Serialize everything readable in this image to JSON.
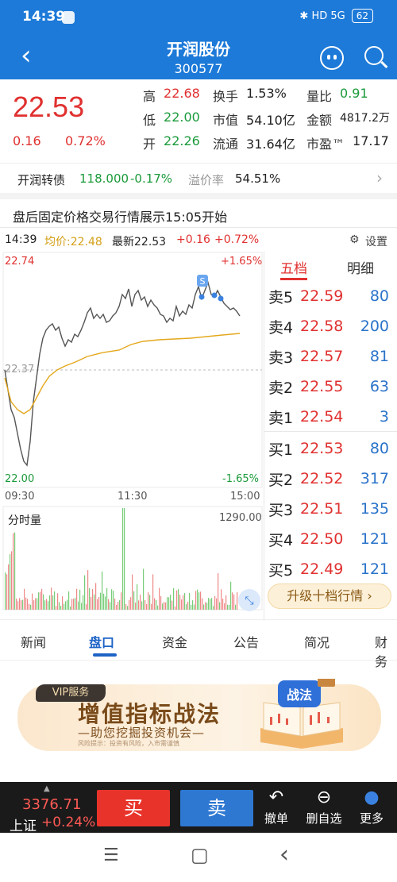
{
  "status_bar": {
    "time": "14:39",
    "icons": "✱ HD 5G",
    "battery": "62"
  },
  "header": {
    "title": "开润股份",
    "code": "300577"
  },
  "quote": {
    "price": "22.53",
    "change": "0.16",
    "change_pct": "0.72%",
    "stats": [
      [
        {
          "label": "高",
          "value": "22.68",
          "color": "red"
        },
        {
          "label": "换手",
          "value": "1.53%",
          "color": "dark"
        },
        {
          "label": "量比",
          "value": "0.91",
          "color": "green"
        }
      ],
      [
        {
          "label": "低",
          "value": "22.00",
          "color": "green"
        },
        {
          "label": "市值",
          "value": "54.10亿",
          "color": "dark"
        },
        {
          "label": "金额",
          "value": "4817.2万",
          "color": "dark"
        }
      ],
      [
        {
          "label": "开",
          "value": "22.26",
          "color": "green"
        },
        {
          "label": "流通",
          "value": "31.64亿",
          "color": "dark"
        },
        {
          "label": "市盈™",
          "value": "17.17",
          "color": "dark"
        }
      ]
    ]
  },
  "bond": {
    "name": "开润转债",
    "price": "118.000",
    "change": "-0.17%",
    "premium_label": "溢价率",
    "premium": "54.51%"
  },
  "notice": "盘后固定价格交易行情展示15:05开始",
  "chart": {
    "time": "14:39",
    "avg_label": "均价:22.48",
    "latest_label": "最新22.53",
    "chg": "+0.16",
    "chg_pct": "+0.72%",
    "settings": "设置",
    "y_high": "22.74",
    "y_mid": "22.37",
    "y_low": "22.00",
    "pct_high": "+1.65%",
    "pct_low": "-1.65%",
    "t_start": "09:30",
    "t_mid": "11:30",
    "t_end": "15:00",
    "volume_label": "分时量",
    "volume_max": "1290.00",
    "marker": "S"
  },
  "orderbook": {
    "tab_active": "五档",
    "tab_other": "明细",
    "asks": [
      {
        "label": "卖5",
        "price": "22.59",
        "vol": "80"
      },
      {
        "label": "卖4",
        "price": "22.58",
        "vol": "200"
      },
      {
        "label": "卖3",
        "price": "22.57",
        "vol": "81"
      },
      {
        "label": "卖2",
        "price": "22.55",
        "vol": "63"
      },
      {
        "label": "卖1",
        "price": "22.54",
        "vol": "3"
      }
    ],
    "bids": [
      {
        "label": "买1",
        "price": "22.53",
        "vol": "80"
      },
      {
        "label": "买2",
        "price": "22.52",
        "vol": "317"
      },
      {
        "label": "买3",
        "price": "22.51",
        "vol": "135"
      },
      {
        "label": "买4",
        "price": "22.50",
        "vol": "121"
      },
      {
        "label": "买5",
        "price": "22.49",
        "vol": "121"
      }
    ],
    "upgrade": "升级十档行情 ›"
  },
  "tabs": [
    "新闻",
    "盘口",
    "资金",
    "公告",
    "简况",
    "财务"
  ],
  "banner": {
    "tag": "VIP服务",
    "title": "增值指标战法",
    "subtitle": "—助您挖掘投资机会—",
    "note": "风险提示：投资有风险，入市需谨慎",
    "book_label": "战法"
  },
  "bottom": {
    "index_value": "3376.71",
    "index_name": "上证",
    "index_change": "+0.24%",
    "buy": "买",
    "sell": "卖",
    "tools": [
      {
        "icon": "↶",
        "label": "撤单"
      },
      {
        "icon": "⊖",
        "label": "删自选"
      },
      {
        "icon": "●",
        "label": "更多"
      }
    ]
  },
  "system_nav": {
    "menu": "☰",
    "home": "▢",
    "back": "‹"
  }
}
